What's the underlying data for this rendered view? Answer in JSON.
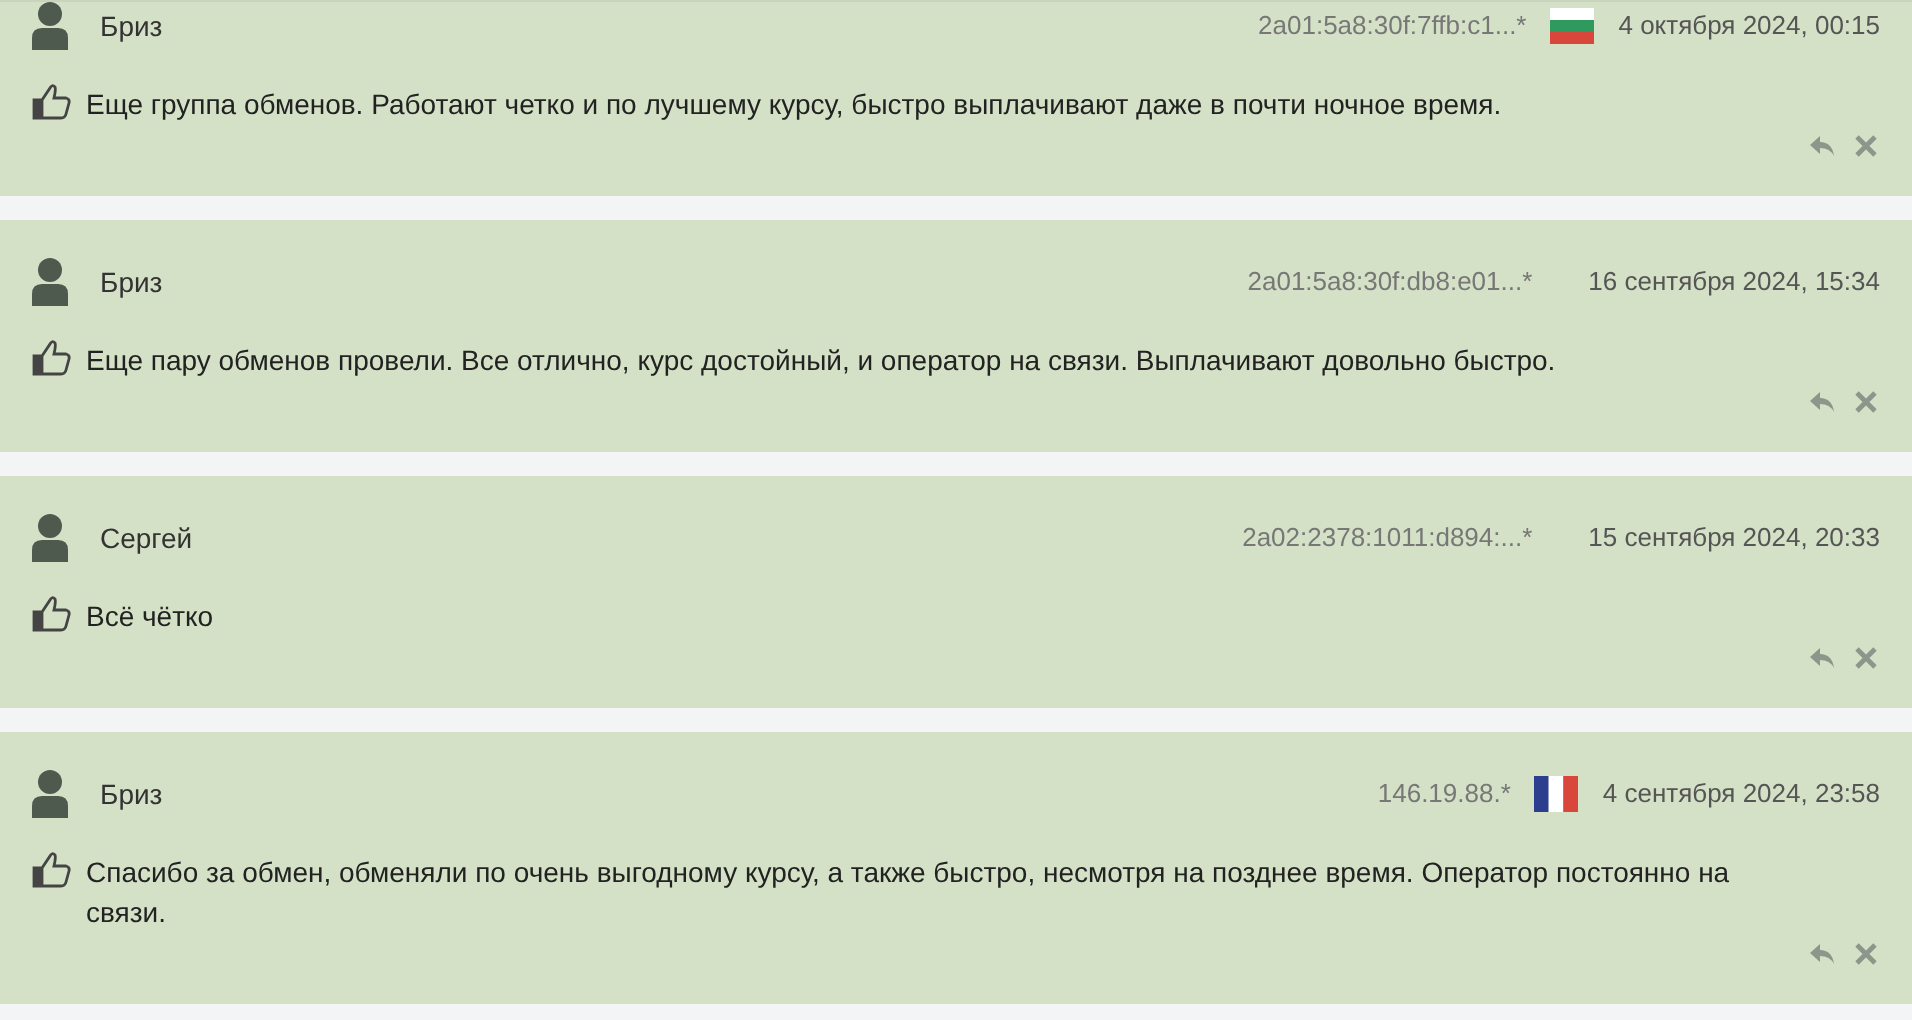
{
  "comments": [
    {
      "author": "Бриз",
      "ip": "2a01:5a8:30f:7ffb:c1...*",
      "kind": "bulgaria",
      "date": "4 октября 2024, 00:15",
      "text": "Еще группа обменов. Работают четко и по лучшему курсу, быстро выплачивают даже в почти ночное время."
    },
    {
      "author": "Бриз",
      "ip": "2a01:5a8:30f:db8:e01...*",
      "kind": "plain",
      "date": "16 сентября 2024, 15:34",
      "text": "Еще пару обменов провели. Все отлично, курс достойный, и оператор на связи. Выплачивают довольно быстро."
    },
    {
      "author": "Сергей",
      "ip": "2a02:2378:1011:d894:...*",
      "kind": "plain",
      "date": "15 сентября 2024, 20:33",
      "text": "Всё чётко"
    },
    {
      "author": "Бриз",
      "ip": "146.19.88.*",
      "kind": "france",
      "date": "4 сентября 2024, 23:58",
      "text": "Спасибо за обмен, обменяли по очень выгодному курсу, а также быстро, несмотря на позднее время. Оператор постоянно на связи."
    }
  ]
}
